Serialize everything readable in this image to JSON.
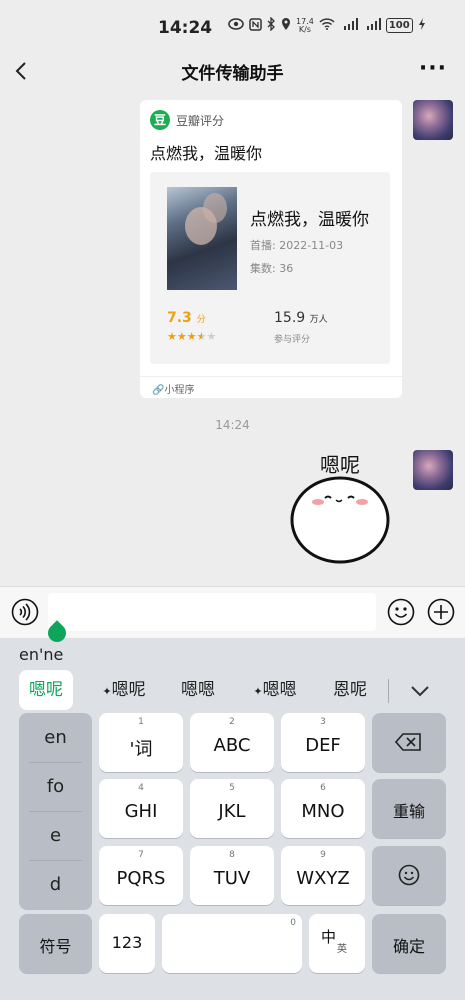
{
  "status_bar": {
    "time": "14:24",
    "speed_value": "17.4",
    "speed_unit": "K/s",
    "battery": "100"
  },
  "header": {
    "title": "文件传输助手"
  },
  "card": {
    "app_name": "豆瓣评分",
    "logo_char": "豆",
    "title": "点燃我，温暖你",
    "movie_name": "点燃我，温暖你",
    "premiere": "首播: 2022-11-03",
    "episodes": "集数: 36",
    "rating_value": "7.3",
    "rating_unit": "分",
    "rating_stars": 3.5,
    "raters_value": "15.9",
    "raters_unit": "万人",
    "raters_label": "参与评分",
    "footer": "小程序"
  },
  "chat": {
    "timestamp": "14:24",
    "sticker_text": "嗯呢"
  },
  "ime": {
    "pinyin": "en'ne",
    "candidates": [
      "嗯呢",
      "嗯呢",
      "嗯嗯",
      "嗯嗯",
      "恩呢"
    ],
    "side_keys": [
      "en",
      "fo",
      "e",
      "d"
    ],
    "keys": [
      {
        "num": "1",
        "label": "'词"
      },
      {
        "num": "2",
        "label": "ABC"
      },
      {
        "num": "3",
        "label": "DEF"
      },
      {
        "num": "4",
        "label": "GHI"
      },
      {
        "num": "5",
        "label": "JKL"
      },
      {
        "num": "6",
        "label": "MNO"
      },
      {
        "num": "7",
        "label": "PQRS"
      },
      {
        "num": "8",
        "label": "TUV"
      },
      {
        "num": "9",
        "label": "WXYZ"
      }
    ],
    "retype": "重输",
    "symbols": "符号",
    "numbers": "123",
    "space_num": "0",
    "lang_main": "中",
    "lang_sub": "英",
    "confirm": "确定"
  },
  "colors": {
    "accent_green": "#0fa55a",
    "douban_green": "#1aad52",
    "rating_orange": "#f0a010"
  }
}
